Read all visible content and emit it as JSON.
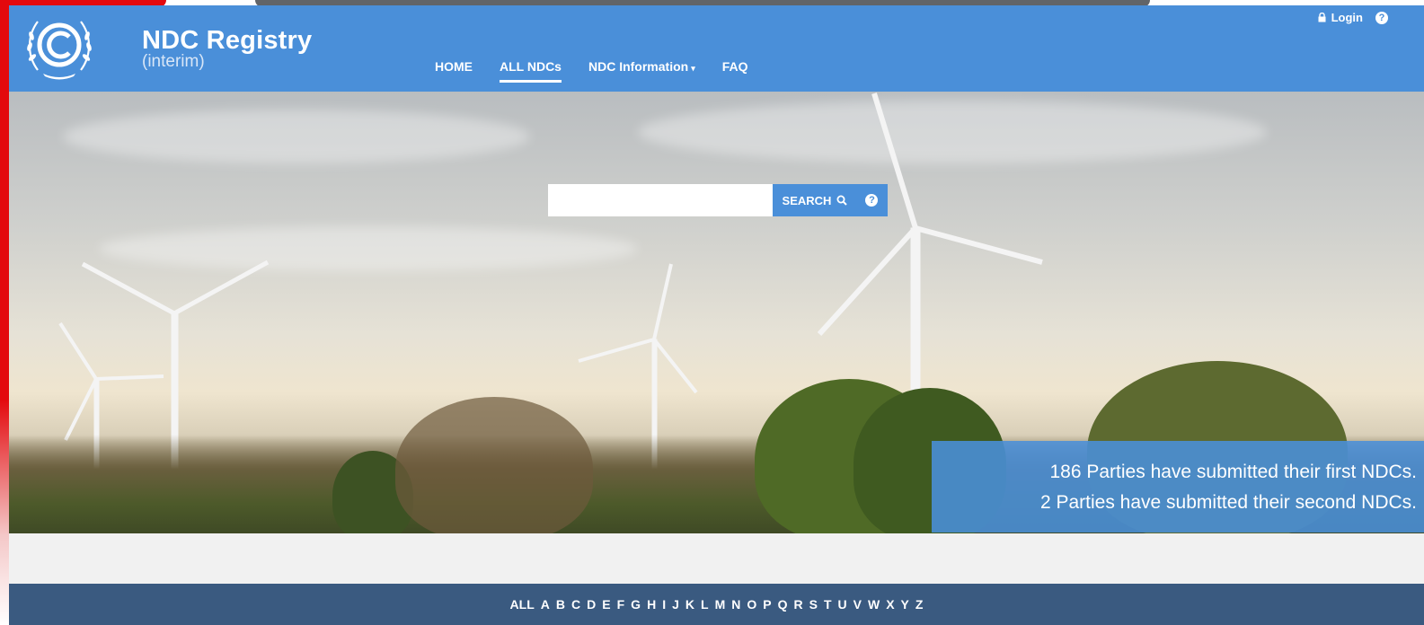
{
  "header": {
    "brand_title": "NDC Registry",
    "brand_subtitle": "(interim)",
    "nav": [
      {
        "label": "HOME",
        "active": false
      },
      {
        "label": "ALL NDCs",
        "active": true
      },
      {
        "label": "NDC Information",
        "active": false,
        "has_dropdown": true
      },
      {
        "label": "FAQ",
        "active": false
      }
    ],
    "login_label": "Login",
    "help_glyph": "?"
  },
  "search": {
    "placeholder": "",
    "button_label": "SEARCH",
    "help_glyph": "?"
  },
  "stats": {
    "line1": "186 Parties have submitted their first NDCs.",
    "line2": "2 Parties have submitted their second NDCs."
  },
  "alphabet": [
    "ALL",
    "A",
    "B",
    "C",
    "D",
    "E",
    "F",
    "G",
    "H",
    "I",
    "J",
    "K",
    "L",
    "M",
    "N",
    "O",
    "P",
    "Q",
    "R",
    "S",
    "T",
    "U",
    "V",
    "W",
    "X",
    "Y",
    "Z"
  ],
  "colors": {
    "header_blue": "#4a8fd9",
    "alpha_bar": "#3a5a80",
    "accent_red": "#e3090d"
  }
}
